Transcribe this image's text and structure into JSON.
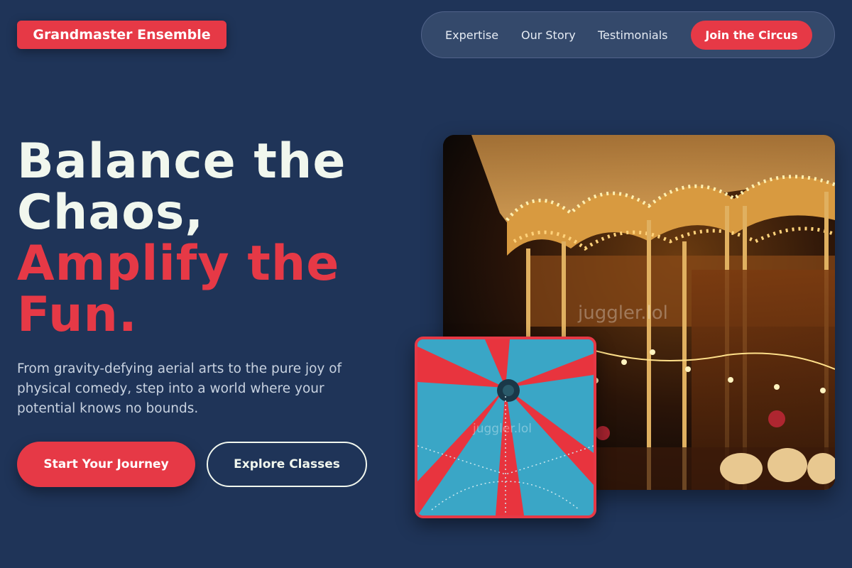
{
  "brand": {
    "name": "Grandmaster Ensemble"
  },
  "nav": {
    "links": [
      "Expertise",
      "Our Story",
      "Testimonials"
    ],
    "cta": "Join the Circus"
  },
  "hero": {
    "headline_line1": "Balance the",
    "headline_line2": "Chaos,",
    "headline_line3": "Amplify the",
    "headline_line4": "Fun.",
    "subtext": "From gravity-defying aerial arts to the pure joy of physical comedy, step into a world where your potential knows no bounds.",
    "primary_button": "Start Your Journey",
    "secondary_button": "Explore Classes"
  },
  "images": {
    "main_watermark": "juggler.lol",
    "small_watermark": "juggler.lol"
  },
  "colors": {
    "background": "#1f3458",
    "accent": "#e63946",
    "text": "#f1f7ee"
  }
}
